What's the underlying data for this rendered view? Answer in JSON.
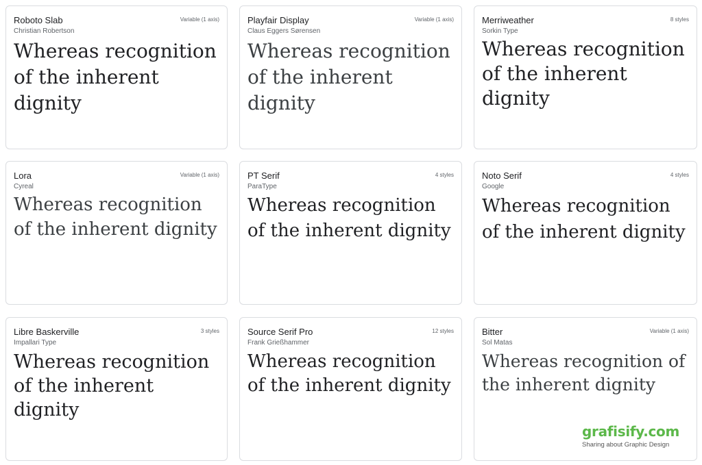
{
  "cards": [
    {
      "name": "Roboto Slab",
      "designer": "Christian Robertson",
      "styles": "Variable (1 axis)",
      "sample": "Whereas recognition of the inherent dignity"
    },
    {
      "name": "Playfair Display",
      "designer": "Claus Eggers Sørensen",
      "styles": "Variable (1 axis)",
      "sample": "Whereas recognition of the inherent dignity"
    },
    {
      "name": "Merriweather",
      "designer": "Sorkin Type",
      "styles": "8 styles",
      "sample": "Whereas recognition of the inherent dignity"
    },
    {
      "name": "Lora",
      "designer": "Cyreal",
      "styles": "Variable (1 axis)",
      "sample": "Whereas recognition of the inherent dignity"
    },
    {
      "name": "PT Serif",
      "designer": "ParaType",
      "styles": "4 styles",
      "sample": "Whereas recognition of the inherent dignity"
    },
    {
      "name": "Noto Serif",
      "designer": "Google",
      "styles": "4 styles",
      "sample": "Whereas recognition of the inherent dignity"
    },
    {
      "name": "Libre Baskerville",
      "designer": "Impallari Type",
      "styles": "3 styles",
      "sample": "Whereas recognition of the inherent dignity"
    },
    {
      "name": "Source Serif Pro",
      "designer": "Frank Grießhammer",
      "styles": "12 styles",
      "sample": "Whereas recognition of the inherent dignity"
    },
    {
      "name": "Bitter",
      "designer": "Sol Matas",
      "styles": "Variable (1 axis)",
      "sample": "Whereas recognition of the inherent dignity"
    }
  ],
  "watermark": {
    "logo": "grafisify.com",
    "tagline": "Sharing about Graphic Design",
    "color": "#5cb84a"
  }
}
